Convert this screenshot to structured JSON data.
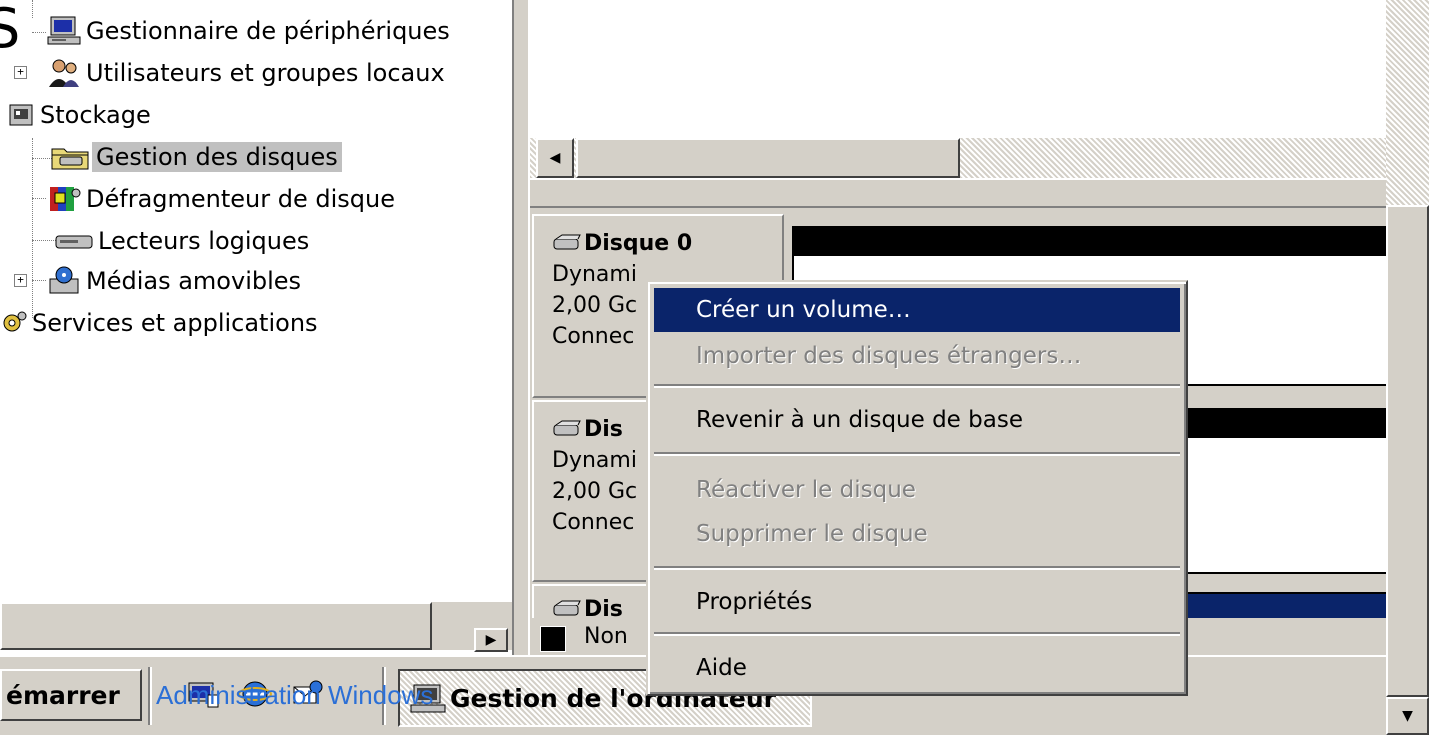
{
  "tree": {
    "items": [
      {
        "label": "Gestionnaire de périphériques",
        "icon": "computer-monitor-icon"
      },
      {
        "label": "Utilisateurs et groupes locaux",
        "icon": "users-groups-icon"
      },
      {
        "label": "Stockage",
        "icon": "storage-icon"
      },
      {
        "label": "Gestion des disques",
        "icon": "disk-management-icon",
        "selected": true
      },
      {
        "label": "Défragmenteur de disque",
        "icon": "defragmenter-icon"
      },
      {
        "label": "Lecteurs logiques",
        "icon": "logical-drive-icon"
      },
      {
        "label": "Médias amovibles",
        "icon": "removable-media-icon"
      },
      {
        "label": "Services et applications",
        "icon": "services-icon"
      }
    ],
    "partial_glyph": "S",
    "expander_symbol": "+",
    "scroll_right_glyph": "▶"
  },
  "upper_scroll_left_glyph": "◀",
  "disks": [
    {
      "title": "Disque 0",
      "type": "Dynami",
      "size": "2,00 Gc",
      "status": "Connec"
    },
    {
      "title": "Dis",
      "type": "Dynami",
      "size": "2,00 Gc",
      "status": "Connec"
    },
    {
      "title": "Dis"
    }
  ],
  "legend": {
    "label": "Non"
  },
  "context_menu": {
    "items": [
      {
        "label": "Créer un volume…",
        "state": "highlighted"
      },
      {
        "label": "Importer des disques étrangers…",
        "state": "disabled"
      },
      {
        "label": "Revenir à un disque de base",
        "state": "enabled"
      },
      {
        "label": "Réactiver le disque",
        "state": "disabled"
      },
      {
        "label": "Supprimer le disque",
        "state": "disabled"
      },
      {
        "label": "Propriétés",
        "state": "enabled"
      },
      {
        "label": "Aide",
        "state": "enabled"
      }
    ]
  },
  "taskbar": {
    "start_label": "émarrer",
    "task_label": "Gestion de l'ordinateur",
    "overlay_caption": "Administration Windows"
  },
  "right_scroll_down_glyph": "▼",
  "colors": {
    "highlight": "#0a246a",
    "face": "#d4d0c8",
    "caption_overlay": "#2b6fd6"
  }
}
